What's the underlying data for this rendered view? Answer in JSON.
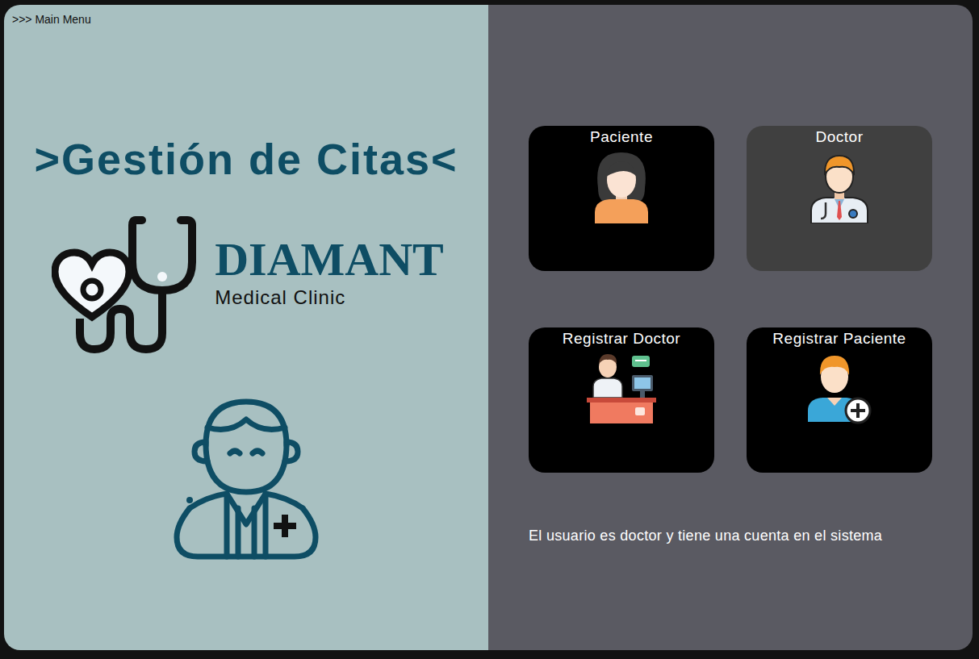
{
  "window": {
    "menu_label": ">>> Main Menu"
  },
  "title": ">Gestión de Citas<",
  "logo": {
    "name": "DIAMANT",
    "subtitle": "Medical Clinic"
  },
  "cards": [
    {
      "label": "Paciente",
      "kind": "patient",
      "selected": false
    },
    {
      "label": "Doctor",
      "kind": "doctor",
      "selected": true
    },
    {
      "label": "Registrar Doctor",
      "kind": "register-doctor",
      "selected": false
    },
    {
      "label": "Registrar Paciente",
      "kind": "register-patient",
      "selected": false
    }
  ],
  "description": "El usuario es doctor y tiene una cuenta en el sistema"
}
